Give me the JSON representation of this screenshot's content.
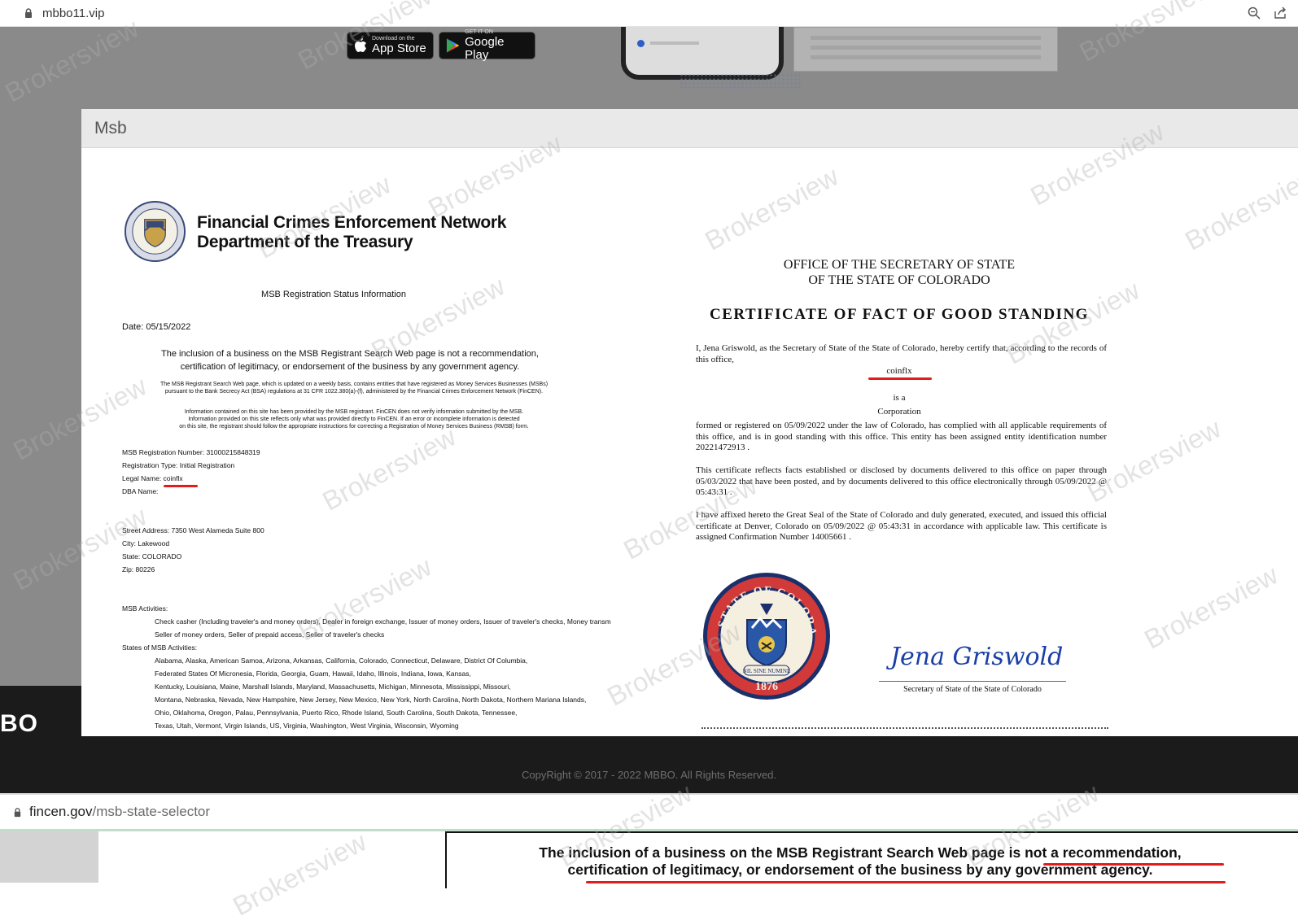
{
  "browser_top": {
    "url": "mbbo11.vip"
  },
  "store": {
    "apple_small": "Download on the",
    "apple_big": "App Store",
    "google_small": "GET IT ON",
    "google_big": "Google Play"
  },
  "footer": {
    "brand": "BO",
    "copyright": "CopyRight © 2017 - 2022 MBBO. All Rights Reserved."
  },
  "modal": {
    "title": "Msb"
  },
  "fincen": {
    "org_line1": "Financial Crimes Enforcement Network",
    "org_line2": "Department of the Treasury",
    "title": "MSB Registration Status Information",
    "date": "Date:  05/15/2022",
    "notice_line1": "The inclusion of a business on the MSB Registrant Search Web page is not a recommendation,",
    "notice_line2": "certification of legitimacy, or endorsement of the business by any government agency.",
    "small1_line1": "The MSB Registrant Search Web page, which is updated on a weekly basis, contains entities that have registered as Money Services Businesses (MSBs)",
    "small1_line2": "pursuant to the Bank Secrecy Act (BSA) regulations at 31 CFR 1022.380(a)-(f), administered by the Financial Crimes Enforcement Network (FinCEN).",
    "small2_line1": "Information contained on this site has been provided by the MSB registrant.  FinCEN does not verify information submitted by the MSB.",
    "small2_line2": "Information provided on this site reflects only what was provided directly to FinCEN.  If an error or incomplete information is detected",
    "small2_line3": "on this site, the registrant should follow the appropriate instructions for correcting a Registration of Money Services Business (RMSB) form.",
    "reg_number": "MSB Registration Number: 31000215848319",
    "reg_type": "Registration Type: Initial Registration",
    "legal_name": "Legal Name: coinflx",
    "dba_name": "DBA Name:",
    "street": "Street Address: 7350 West Alameda Suite 800",
    "city": "City: Lakewood",
    "state": "State: COLORADO",
    "zip": "Zip: 80226",
    "activities_label": "MSB Activities:",
    "activities_line1": "Check casher (Including traveler's and money orders), Dealer in foreign exchange, Issuer of money orders, Issuer of traveler's checks, Money transm",
    "activities_line2": "Seller of money orders, Seller of prepaid access, Seller of traveler's checks",
    "states_label": "States of MSB Activities:",
    "states": [
      "Alabama, Alaska, American Samoa, Arizona, Arkansas, California, Colorado, Connecticut, Delaware, District Of Columbia,",
      "Federated States Of Micronesia, Florida, Georgia, Guam, Hawaii, Idaho, Illinois, Indiana, Iowa, Kansas,",
      "Kentucky, Louisiana, Maine, Marshall Islands, Maryland, Massachusetts, Michigan, Minnesota, Mississippi, Missouri,",
      "Montana, Nebraska, Nevada, New Hampshire, New Jersey, New Mexico, New York, North Carolina, North Dakota, Northern Mariana Islands,",
      "Ohio, Oklahoma, Oregon, Palau, Pennsylvania, Puerto Rico, Rhode Island, South Carolina, South Dakota, Tennessee,",
      "Texas, Utah, Vermont, Virgin Islands, US, Virginia, Washington, West Virginia, Wisconsin, Wyoming"
    ]
  },
  "colorado": {
    "office_line1": "OFFICE OF THE SECRETARY OF STATE",
    "office_line2": "OF THE STATE OF COLORADO",
    "cert_title": "CERTIFICATE OF FACT OF GOOD STANDING",
    "p1": "I, Jena Griswold, as the Secretary of State of the State of Colorado, hereby certify that, according to the records of this office,",
    "entity": "coinflx",
    "is_a": "is a",
    "entity_type": "Corporation",
    "p2": "formed or registered on 05/09/2022  under the law of Colorado, has complied with all applicable requirements of this office, and is in good standing with this office.  This entity has been assigned entity identification number 20221472913 .",
    "p3": "This certificate reflects facts established or disclosed by documents delivered to this office on paper through 05/03/2022  that have been posted, and by documents delivered to this office electronically through 05/09/2022 @ 05:43:31 .",
    "p4": "I have affixed hereto the Great Seal of the State of Colorado and duly generated, executed, and issued this official certificate at Denver, Colorado on 05/09/2022  @  05:43:31  in accordance with applicable law. This certificate is assigned Confirmation Number 14005661     .",
    "seal_top": "STATE OF COLORADO",
    "seal_motto": "NIL SINE NUMINE",
    "seal_year": "1876",
    "signature": "Jena Griswold",
    "sig_caption": "Secretary of State of the State of Colorado"
  },
  "browser_bottom": {
    "url_domain": "fincen.gov",
    "url_path": "/msb-state-selector"
  },
  "bottom_notice": {
    "line1": "The inclusion of a business on the MSB Registrant Search Web page is not a recommendation,",
    "line2": "certification of legitimacy, or endorsement of the business by any government agency."
  },
  "watermark": "Brokersview",
  "colors": {
    "underline_red": "#e31b1b",
    "footer_dark": "#1b1b1b",
    "modal_header": "#e9e9e9"
  }
}
